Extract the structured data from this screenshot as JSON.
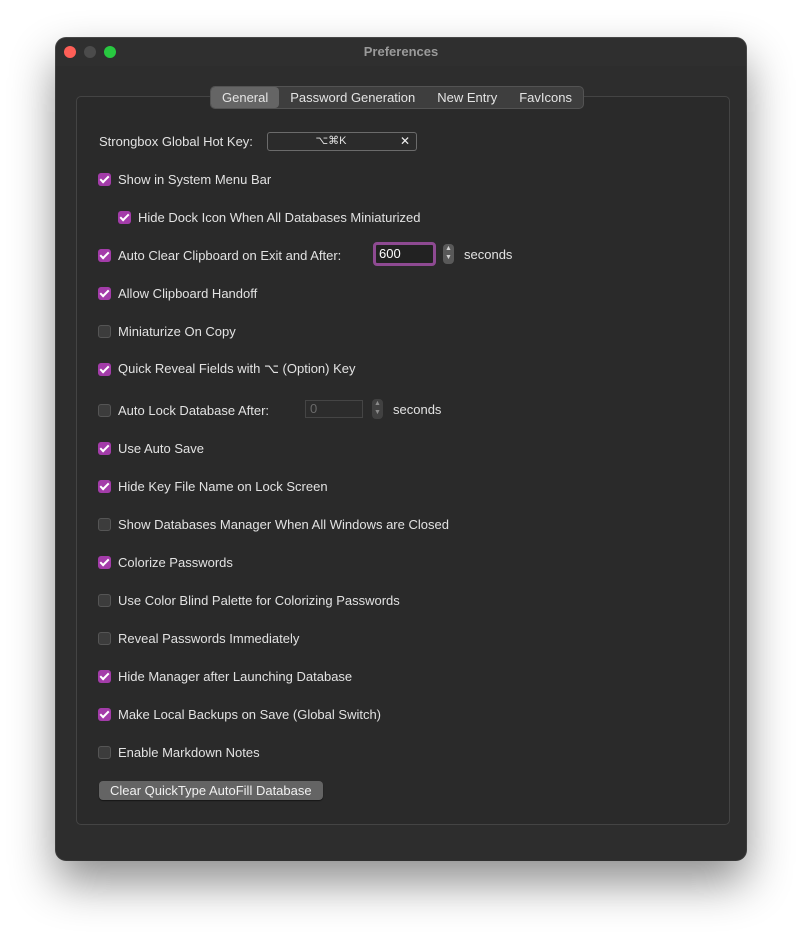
{
  "window": {
    "title": "Preferences"
  },
  "tabs": [
    {
      "label": "General"
    },
    {
      "label": "Password Generation"
    },
    {
      "label": "New Entry"
    },
    {
      "label": "FavIcons"
    }
  ],
  "hotkey": {
    "label": "Strongbox Global Hot Key:",
    "value": "⌥⌘K",
    "clear_symbol": "✕"
  },
  "options": {
    "show_menu_bar": {
      "label": "Show in System Menu Bar",
      "checked": true
    },
    "hide_dock_icon": {
      "label": "Hide Dock Icon When All Databases Miniaturized",
      "checked": true
    },
    "auto_clear_clipboard": {
      "label": "Auto Clear Clipboard on Exit and After:",
      "checked": true,
      "value": "600",
      "unit": "seconds"
    },
    "clipboard_handoff": {
      "label": "Allow Clipboard Handoff",
      "checked": true
    },
    "miniaturize_on_copy": {
      "label": "Miniaturize On Copy",
      "checked": false
    },
    "quick_reveal": {
      "label": "Quick Reveal Fields with ⌥ (Option) Key",
      "checked": true
    },
    "auto_lock": {
      "label": "Auto Lock Database After:",
      "checked": false,
      "value": "0",
      "unit": "seconds"
    },
    "auto_save": {
      "label": "Use Auto Save",
      "checked": true
    },
    "hide_key_file": {
      "label": "Hide Key File Name on Lock Screen",
      "checked": true
    },
    "show_db_manager": {
      "label": "Show Databases Manager When All Windows are Closed",
      "checked": false
    },
    "colorize_passwords": {
      "label": "Colorize Passwords",
      "checked": true
    },
    "color_blind": {
      "label": "Use Color Blind Palette for Colorizing Passwords",
      "checked": false
    },
    "reveal_immediately": {
      "label": "Reveal Passwords Immediately",
      "checked": false
    },
    "hide_manager": {
      "label": "Hide Manager after Launching Database",
      "checked": true
    },
    "local_backups": {
      "label": "Make Local Backups on Save (Global Switch)",
      "checked": true
    },
    "markdown_notes": {
      "label": "Enable Markdown Notes",
      "checked": false
    }
  },
  "clear_quicktype_label": "Clear QuickType AutoFill Database",
  "colors": {
    "accent": "#a33ca9",
    "window_bg": "#2d2d2d",
    "text": "#e2e2e2"
  }
}
